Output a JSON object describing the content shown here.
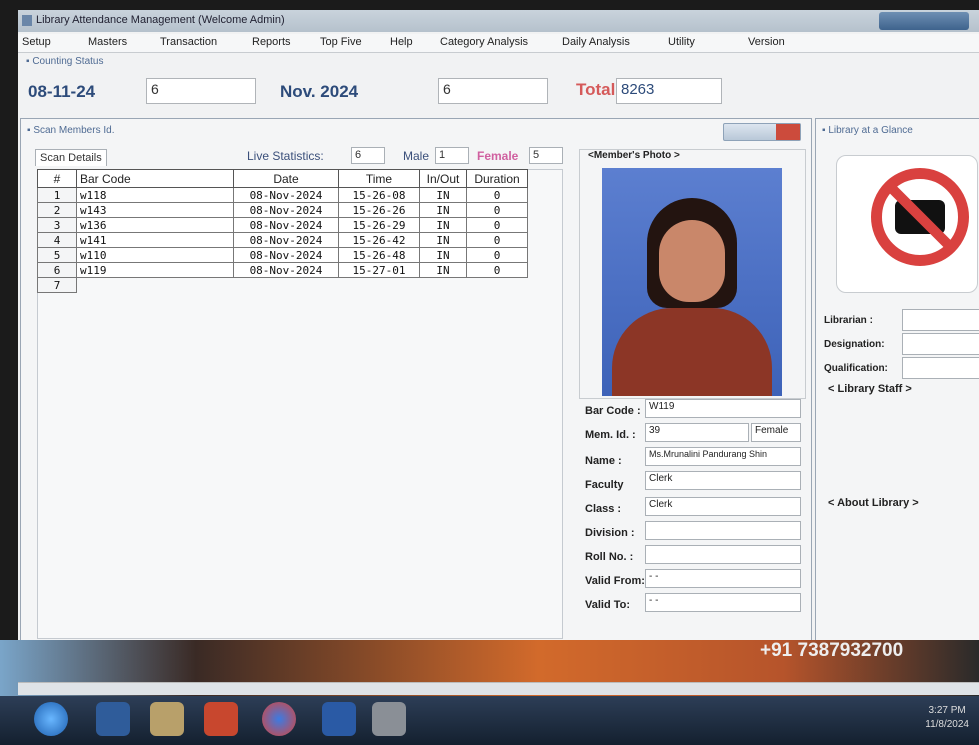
{
  "window": {
    "title": "Library Attendance Management (Welcome Admin)"
  },
  "menu": [
    "Setup",
    "Masters",
    "Transaction",
    "Reports",
    "Top Five",
    "Help",
    "Category Analysis",
    "Daily Analysis",
    "Utility",
    "Version"
  ],
  "counting": {
    "header": "Counting Status",
    "date": "08-11-24",
    "day_count": "6",
    "month": "Nov. 2024",
    "month_count": "6",
    "total_label": "Total :",
    "total_value": "8263"
  },
  "scan_panel": {
    "title": "Scan Members Id.",
    "tab": "Scan Details",
    "live_label": "Live Statistics:",
    "live_value": "6",
    "male_label": "Male",
    "male_value": "1",
    "female_label": "Female",
    "female_value": "5",
    "columns": [
      "#",
      "Bar Code",
      "Date",
      "Time",
      "In/Out",
      "Duration"
    ],
    "rows": [
      [
        "1",
        "w118",
        "08-Nov-2024",
        "15-26-08",
        "IN",
        "0"
      ],
      [
        "2",
        "w143",
        "08-Nov-2024",
        "15-26-26",
        "IN",
        "0"
      ],
      [
        "3",
        "w136",
        "08-Nov-2024",
        "15-26-29",
        "IN",
        "0"
      ],
      [
        "4",
        "w141",
        "08-Nov-2024",
        "15-26-42",
        "IN",
        "0"
      ],
      [
        "5",
        "w110",
        "08-Nov-2024",
        "15-26-48",
        "IN",
        "0"
      ],
      [
        "6",
        "w119",
        "08-Nov-2024",
        "15-27-01",
        "IN",
        "0"
      ],
      [
        "7",
        "",
        "",
        "",
        "",
        ""
      ]
    ]
  },
  "member": {
    "photo_label": "<Member's Photo >",
    "bar_code_label": "Bar Code :",
    "bar_code": "W119",
    "mem_id_label": "Mem. Id. :",
    "mem_id": "39",
    "gender": "Female",
    "name_label": "Name :",
    "name": "Ms.Mrunalini Pandurang Shin",
    "faculty_label": "Faculty",
    "faculty": "Clerk",
    "class_label": "Class :",
    "class": "Clerk",
    "division_label": "Division :",
    "division": "",
    "roll_label": "Roll No. :",
    "roll": "",
    "valid_from_label": "Valid From:",
    "valid_from": "- -",
    "valid_to_label": "Valid To:",
    "valid_to": "- -"
  },
  "glance": {
    "title": "Library at a Glance",
    "librarian_label": "Librarian :",
    "designation_label": "Designation:",
    "qualification_label": "Qualification:",
    "staff_label": "< Library Staff >",
    "about_label": "< About Library >"
  },
  "desktop": {
    "phone": "+91 7387932700"
  },
  "taskbar": {
    "time": "3:27 PM",
    "date": "11/8/2024"
  }
}
